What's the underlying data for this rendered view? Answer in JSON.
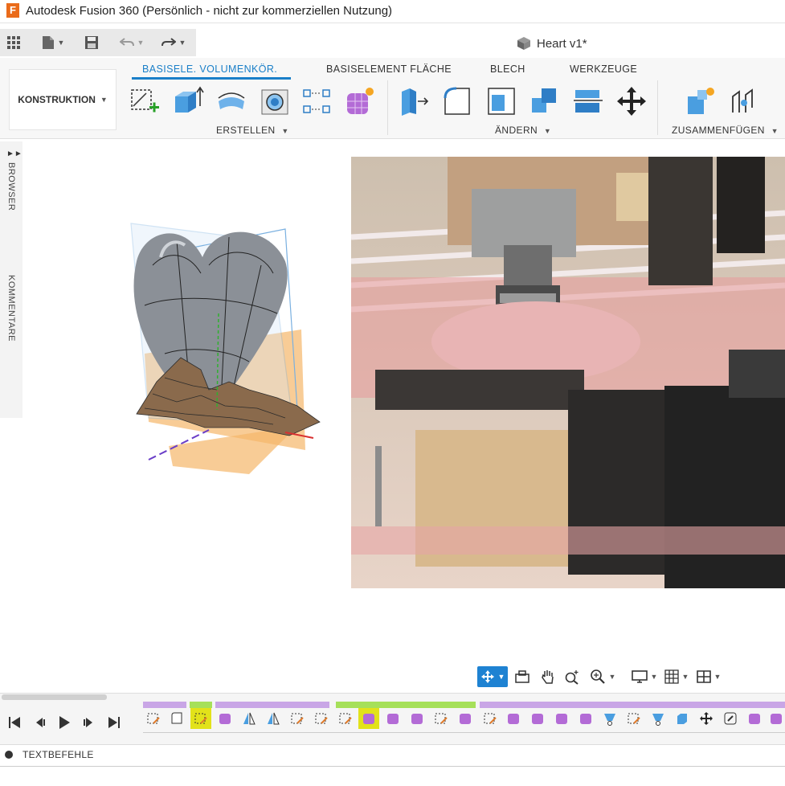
{
  "window": {
    "logo_letter": "F",
    "title": "Autodesk Fusion 360 (Persönlich - nicht zur kommerziellen Nutzung)"
  },
  "quick_access": {
    "icons": [
      "apps-grid-icon",
      "file-icon",
      "save-icon",
      "undo-icon",
      "redo-icon"
    ]
  },
  "document_tab": {
    "title": "Heart v1*"
  },
  "ribbon": {
    "workspace": "KONSTRUKTION",
    "tabs": [
      "BASISELE. VOLUMENKÖR.",
      "BASISELEMENT FLÄCHE",
      "BLECH",
      "WERKZEUGE"
    ],
    "active_tab_color": "#1a7fc8",
    "groups": {
      "create": "ERSTELLEN",
      "modify": "ÄNDERN",
      "assemble": "ZUSAMMENFÜGEN"
    }
  },
  "side_panel": {
    "browser": "BROWSER",
    "comments": "KOMMENTARE"
  },
  "viewport": {
    "model": "heart-mesh",
    "canvas_image": "cnc-milling-photo"
  },
  "navigation_bar": {
    "icons": [
      "orbit-icon",
      "look-at-icon",
      "pan-icon",
      "zoom-window-icon",
      "zoom-icon",
      "display-settings-icon",
      "grid-icon",
      "viewports-icon"
    ]
  },
  "timeline": {
    "controls": [
      "go-to-start",
      "step-back",
      "play",
      "step-forward",
      "go-to-end"
    ],
    "colors": {
      "sketch_bar": "#c9a6e6",
      "feature_bar": "#a6e05a",
      "highlight": "#e2e21a"
    }
  },
  "text_commands": {
    "label": "TEXTBEFEHLE"
  }
}
